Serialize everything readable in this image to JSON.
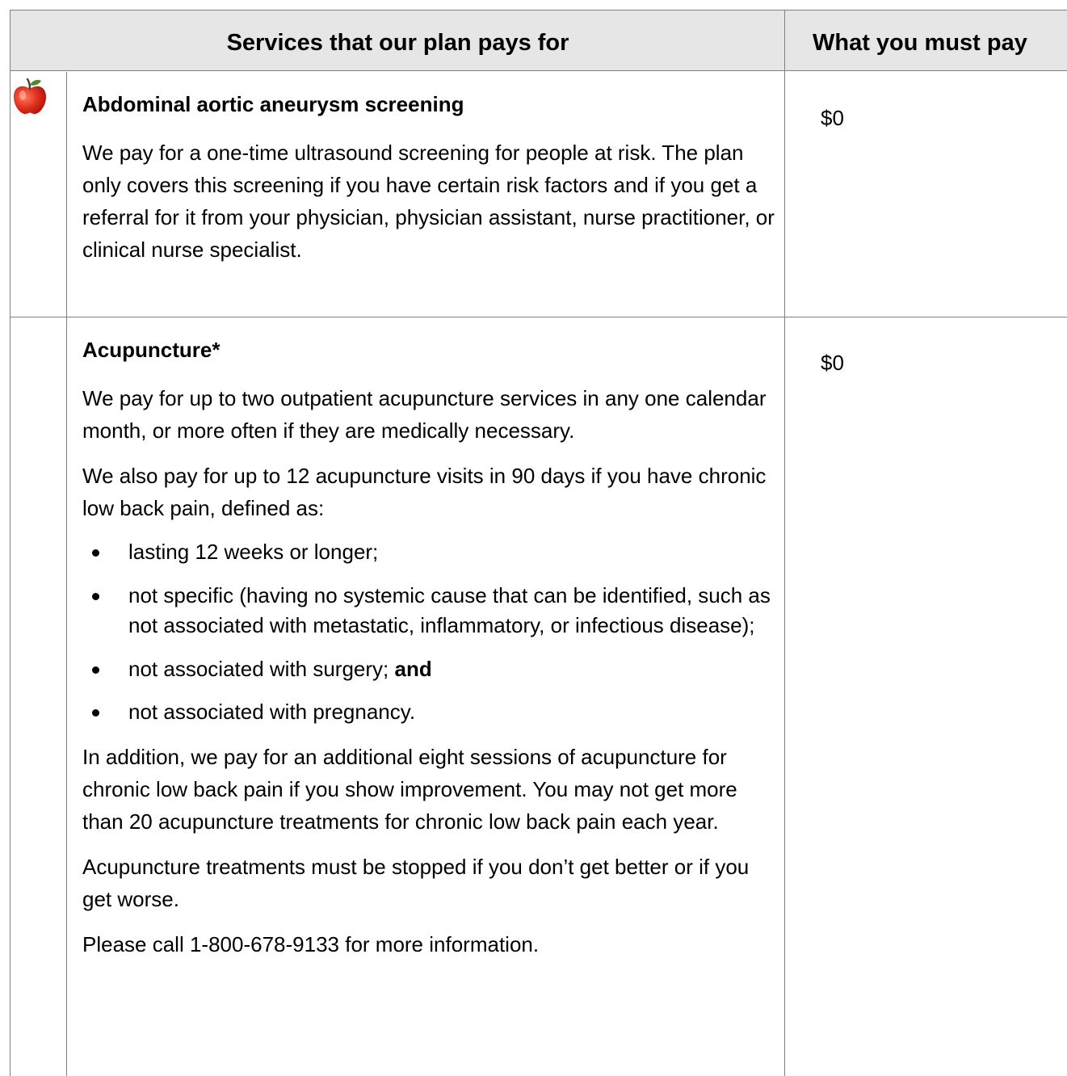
{
  "header": {
    "services_label": "Services that our plan pays for",
    "pay_label": "What you must pay"
  },
  "rows": [
    {
      "icon": "apple-icon",
      "title": "Abdominal aortic aneurysm screening",
      "paragraphs": [
        "We pay for a one-time ultrasound screening for people at risk. The plan only covers this screening if you have certain risk factors and if you get a referral for it from your physician, physician assistant, nurse practitioner, or clinical nurse specialist."
      ],
      "cost": "$0"
    },
    {
      "title": "Acupuncture*",
      "paragraphs": [
        "We pay for up to two outpatient acupuncture services in any one calendar month, or more often if they are medically necessary.",
        "We also pay for up to 12 acupuncture visits in 90 days if you have chronic low back pain, defined as:"
      ],
      "bullets": [
        "lasting 12 weeks or longer;",
        "not specific (having no systemic cause that can be identified, such as not associated with metastatic, inflammatory, or infectious disease);",
        "not associated with surgery;",
        "not associated with pregnancy."
      ],
      "bullet_suffix_bold": "and",
      "after_paragraphs": [
        "In addition, we pay for an additional eight sessions of acupuncture for chronic low back pain if you show improvement. You may not get more than 20 acupuncture treatments for chronic low back pain each year.",
        "Acupuncture treatments must be stopped if you don’t get better or if you get worse.",
        "Please call 1-800-678-9133 for more information."
      ],
      "cost": "$0"
    }
  ],
  "colors": {
    "header_bg": "#e6e6e6",
    "border": "#7f7f7f",
    "apple_red": "#e0301e"
  }
}
